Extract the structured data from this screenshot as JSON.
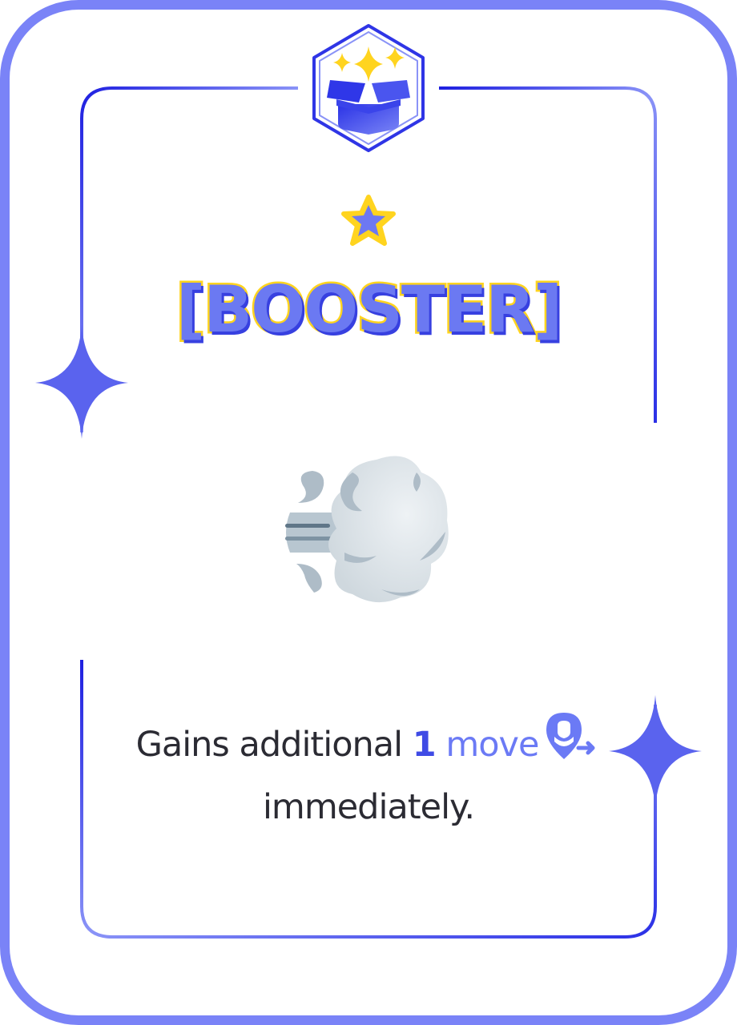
{
  "card": {
    "type_label": "[BOOSTER]",
    "effect": {
      "prefix": "Gains additional ",
      "amount": "1",
      "unit": "move",
      "suffix": "immediately."
    },
    "icons": {
      "badge": "gift-box-sparkles-icon",
      "rarity": "star-icon",
      "art": "wind-blowing-cloud-icon",
      "inline": "move-location-icon"
    },
    "colors": {
      "frame_outer": "#7a83f7",
      "frame_inner": "#2a2fe0",
      "accent_yellow": "#ffd41f",
      "accent_blue": "#3f4be5",
      "text": "#2b2b33"
    }
  }
}
